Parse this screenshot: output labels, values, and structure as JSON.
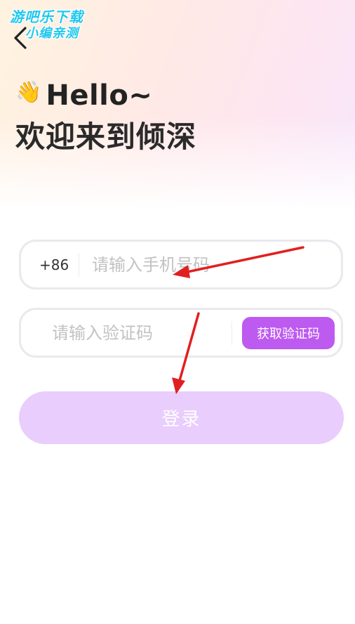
{
  "watermark": {
    "line1": "游吧乐下载",
    "line2": "小编亲测"
  },
  "header": {
    "back_icon": "chevron-left-icon",
    "wave_icon": "👋",
    "hello": "Hello~",
    "welcome": "欢迎来到倾深"
  },
  "phone": {
    "country_code": "+86",
    "placeholder": "请输入手机号码",
    "value": ""
  },
  "code": {
    "placeholder": "请输入验证码",
    "value": "",
    "get_code_label": "获取验证码"
  },
  "login": {
    "label": "登录"
  },
  "colors": {
    "accent": "#bd5af0",
    "login_disabled": "#e9cdfd",
    "annotation_arrow": "#e02020"
  }
}
